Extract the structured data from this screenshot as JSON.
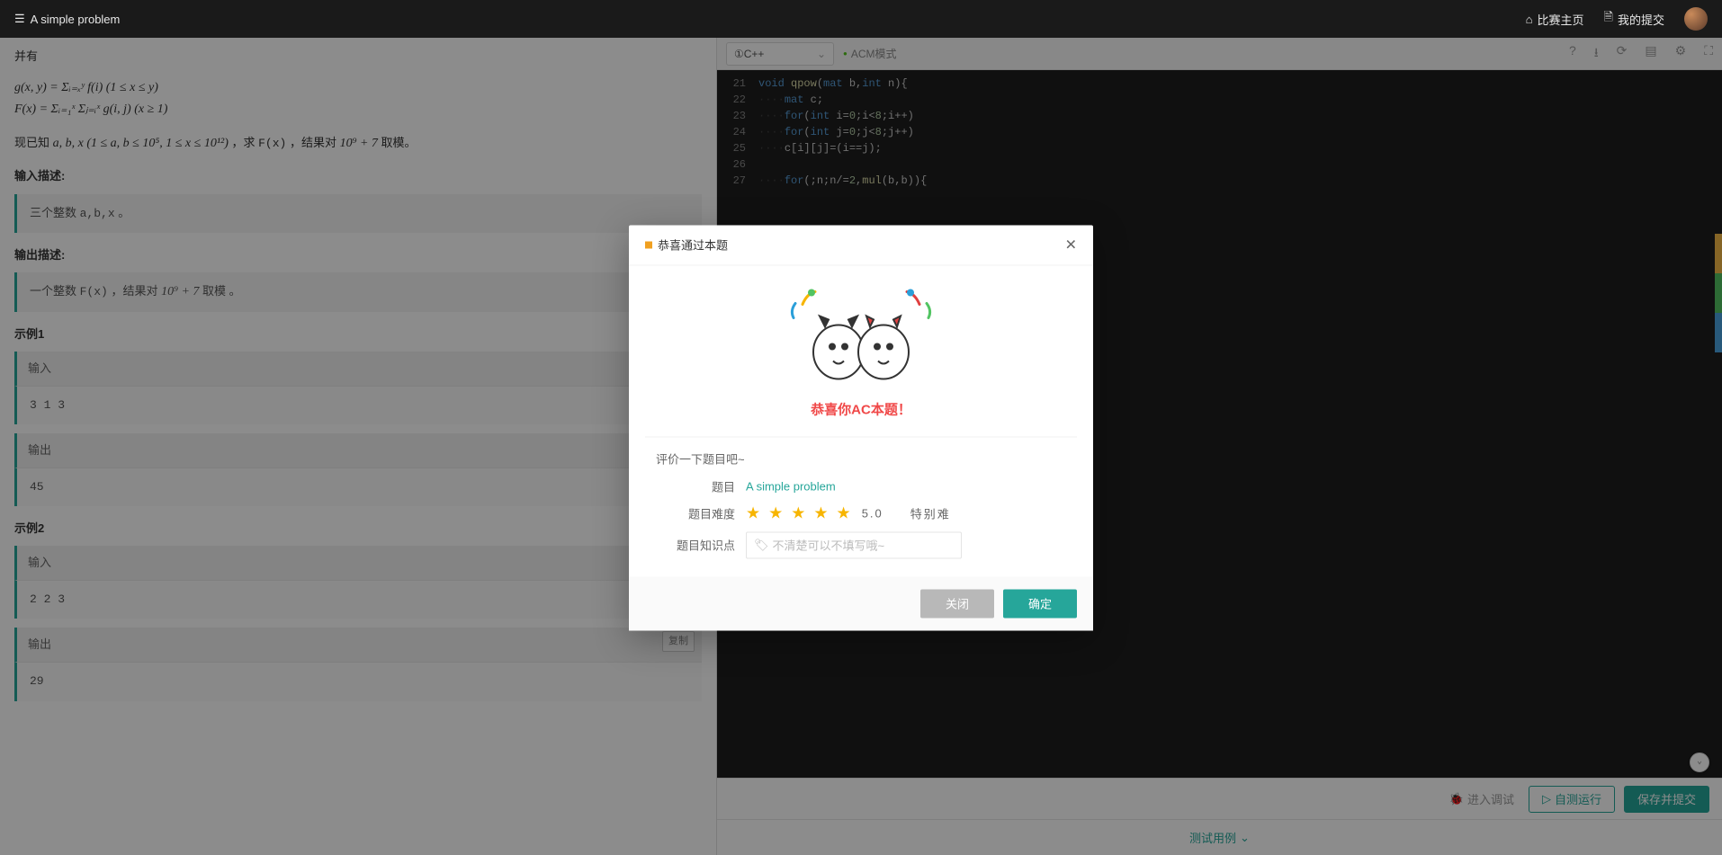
{
  "header": {
    "problem_title": "A simple problem",
    "home_link": "比赛主页",
    "submissions_link": "我的提交"
  },
  "problem": {
    "pre_text": "并有",
    "math_line1": "g(x, y) = Σᵢ₌ₓʸ f(i)      (1 ≤ x ≤ y)",
    "math_line2": "F(x) = Σᵢ₌₁ˣ Σⱼ₌ᵢˣ g(i, j)      (x ≥ 1)",
    "known_prefix": "现已知 ",
    "known_vars": "a, b, x (1 ≤ a, b ≤ 10⁵, 1 ≤ x ≤ 10¹²)",
    "known_suffix1": "，求 ",
    "known_fx": "F(x)",
    "known_suffix2": "，结果对 ",
    "known_mod": "10⁹ + 7",
    "known_suffix3": " 取模。",
    "input_desc_label": "输入描述:",
    "input_desc_body": "三个整数 a,b,x 。",
    "output_desc_label": "输出描述:",
    "output_desc_body_pre": "一个整数 ",
    "output_desc_fx": "F(x)",
    "output_desc_body_mid": "，结果对  ",
    "output_desc_mod": "10⁹ + 7",
    "output_desc_body_suf": " 取模 。",
    "example1_label": "示例1",
    "example2_label": "示例2",
    "input_label": "输入",
    "output_label": "输出",
    "copy_label": "复制",
    "ex1_in": "3 1 3",
    "ex1_out": "45",
    "ex2_in": "2 2 3",
    "ex2_out": "29"
  },
  "editor": {
    "language": "①C++",
    "mode": "ACM模式",
    "icons": {
      "help": "?",
      "download": "⭳",
      "refresh": "⟳",
      "notes": "▤",
      "settings": "⚙",
      "fullscreen": "⛶"
    },
    "line_start": 21,
    "lines": [
      "void qpow(mat b,int n){",
      "····mat c;",
      "····for(int i=0;i<8;i++)",
      "····for(int j=0;j<8;j++)",
      "····c[i][j]=(i==j);",
      "",
      "····for(;n;n/=2,mul(b,b)){"
    ]
  },
  "footer": {
    "debug": "进入调试",
    "selftest": "自测运行",
    "submit": "保存并提交",
    "testcases": "测试用例"
  },
  "modal": {
    "title": "恭喜通过本题",
    "congrats": "恭喜你AC本题！",
    "rate_prompt": "评价一下题目吧~",
    "label_problem": "题目",
    "problem_name": "A simple problem",
    "label_difficulty": "题目难度",
    "score": "5.0",
    "diff_text": "特别难",
    "label_tags": "题目知识点",
    "tag_placeholder": "不清楚可以不填写哦~",
    "close_btn": "关闭",
    "confirm_btn": "确定"
  }
}
